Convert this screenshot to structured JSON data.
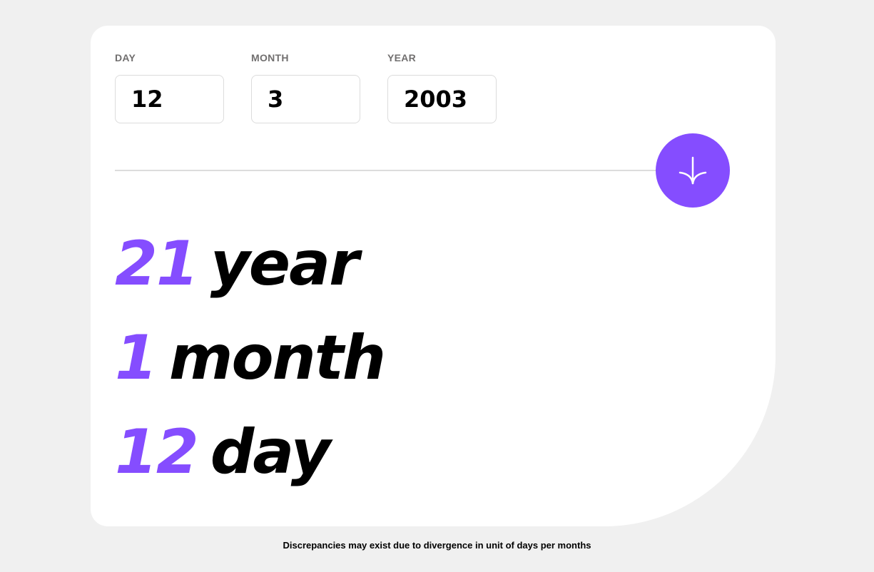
{
  "form": {
    "day": {
      "label": "DAY",
      "value": "12"
    },
    "month": {
      "label": "MONTH",
      "value": "3"
    },
    "year": {
      "label": "YEAR",
      "value": "2003"
    }
  },
  "submit": {
    "icon": "arrow-down-icon",
    "color": "#854dff"
  },
  "results": {
    "years": {
      "value": "21",
      "unit": "year"
    },
    "months": {
      "value": "1",
      "unit": "month"
    },
    "days": {
      "value": "12",
      "unit": "day"
    }
  },
  "footnote": "Discrepancies may exist due to divergence in unit of days per months",
  "colors": {
    "accent": "#854dff",
    "background": "#f0f0f0",
    "card": "#ffffff",
    "label": "#716f6f"
  }
}
